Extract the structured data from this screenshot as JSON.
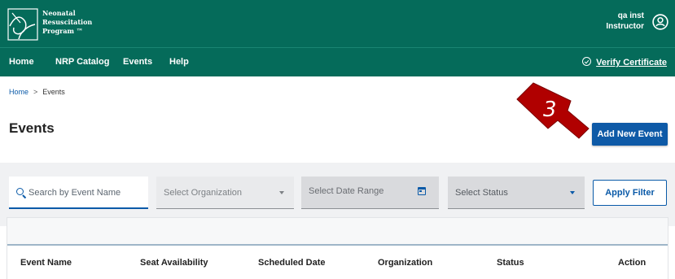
{
  "header": {
    "logo_lines": [
      "Neonatal",
      "Resuscitation",
      "Program ™"
    ],
    "user_name": "qa inst",
    "user_role": "Instructor"
  },
  "nav": {
    "items": [
      "Home",
      "NRP Catalog",
      "Events",
      "Help"
    ],
    "verify_label": "Verify Certificate"
  },
  "breadcrumb": {
    "home": "Home",
    "separator": ">",
    "current": "Events"
  },
  "page": {
    "title": "Events",
    "add_button": "Add New Event",
    "annotation_number": "3"
  },
  "filters": {
    "search_placeholder": "Search by Event Name",
    "organization": "Select Organization",
    "date_range": "Select Date Range",
    "status": "Select Status",
    "apply_button": "Apply Filter"
  },
  "table": {
    "columns": [
      "Event Name",
      "Seat Availability",
      "Scheduled Date",
      "Organization",
      "Status",
      "Action"
    ]
  },
  "colors": {
    "brand_green": "#056b5a",
    "primary_blue": "#0e5aa7",
    "annotation_red": "#b00000"
  }
}
